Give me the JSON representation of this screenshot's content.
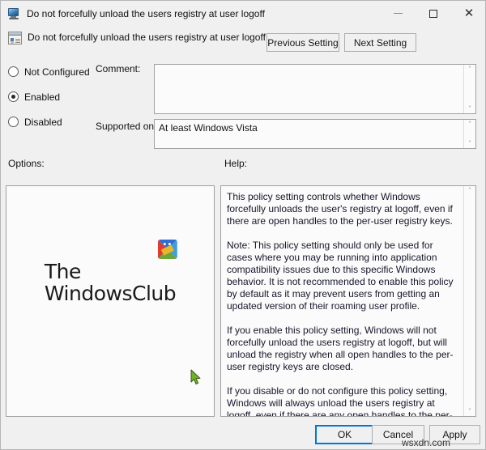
{
  "window": {
    "title": "Do not forcefully unload the users registry at user logoff",
    "title_icon": "monitor-policy-icon",
    "controls": {
      "minimize": "minimize-icon",
      "maximize": "maximize-icon",
      "close": "close-icon"
    }
  },
  "header": {
    "policy_icon": "group-policy-setting-icon",
    "title": "Do not forcefully unload the users registry at user logoff",
    "previous_setting": "Previous Setting",
    "next_setting": "Next Setting"
  },
  "state_options": [
    {
      "label": "Not Configured",
      "selected": false
    },
    {
      "label": "Enabled",
      "selected": true
    },
    {
      "label": "Disabled",
      "selected": false
    }
  ],
  "comment": {
    "label": "Comment:",
    "value": ""
  },
  "supported_on": {
    "label": "Supported on:",
    "value": "At least Windows Vista"
  },
  "options": {
    "label": "Options:",
    "logo": {
      "line1": "The",
      "line2": "Windows",
      "line3": "Club"
    }
  },
  "help": {
    "label": "Help:",
    "paragraphs": [
      "This policy setting  controls whether Windows forcefully unloads the user's registry at logoff, even if there are open handles to the per-user registry keys.",
      "Note: This policy setting should only be used for cases where you may be running into application compatibility issues due to this specific Windows behavior. It is not recommended to enable this policy by default as it may prevent users from getting an updated version of their roaming user profile.",
      "If you enable this policy setting, Windows will not forcefully unload the users registry at logoff, but will unload the registry when all open handles to the per-user registry keys are closed.",
      "If you disable or do not configure this policy setting, Windows will always unload the users registry at logoff, even if there are any open handles to the per-user registry keys at user logoff."
    ]
  },
  "footer": {
    "ok": "OK",
    "cancel": "Cancel",
    "apply": "Apply"
  },
  "watermark": "wsxdn.com",
  "scroll_arrows": {
    "up": "˄",
    "down": "˅"
  },
  "colors": {
    "window_bg": "#f0f0f0",
    "field_bg": "#fbfbfb",
    "border": "#a0a0a0",
    "focus_accent": "#0078d7",
    "help_text": "#16162b"
  }
}
